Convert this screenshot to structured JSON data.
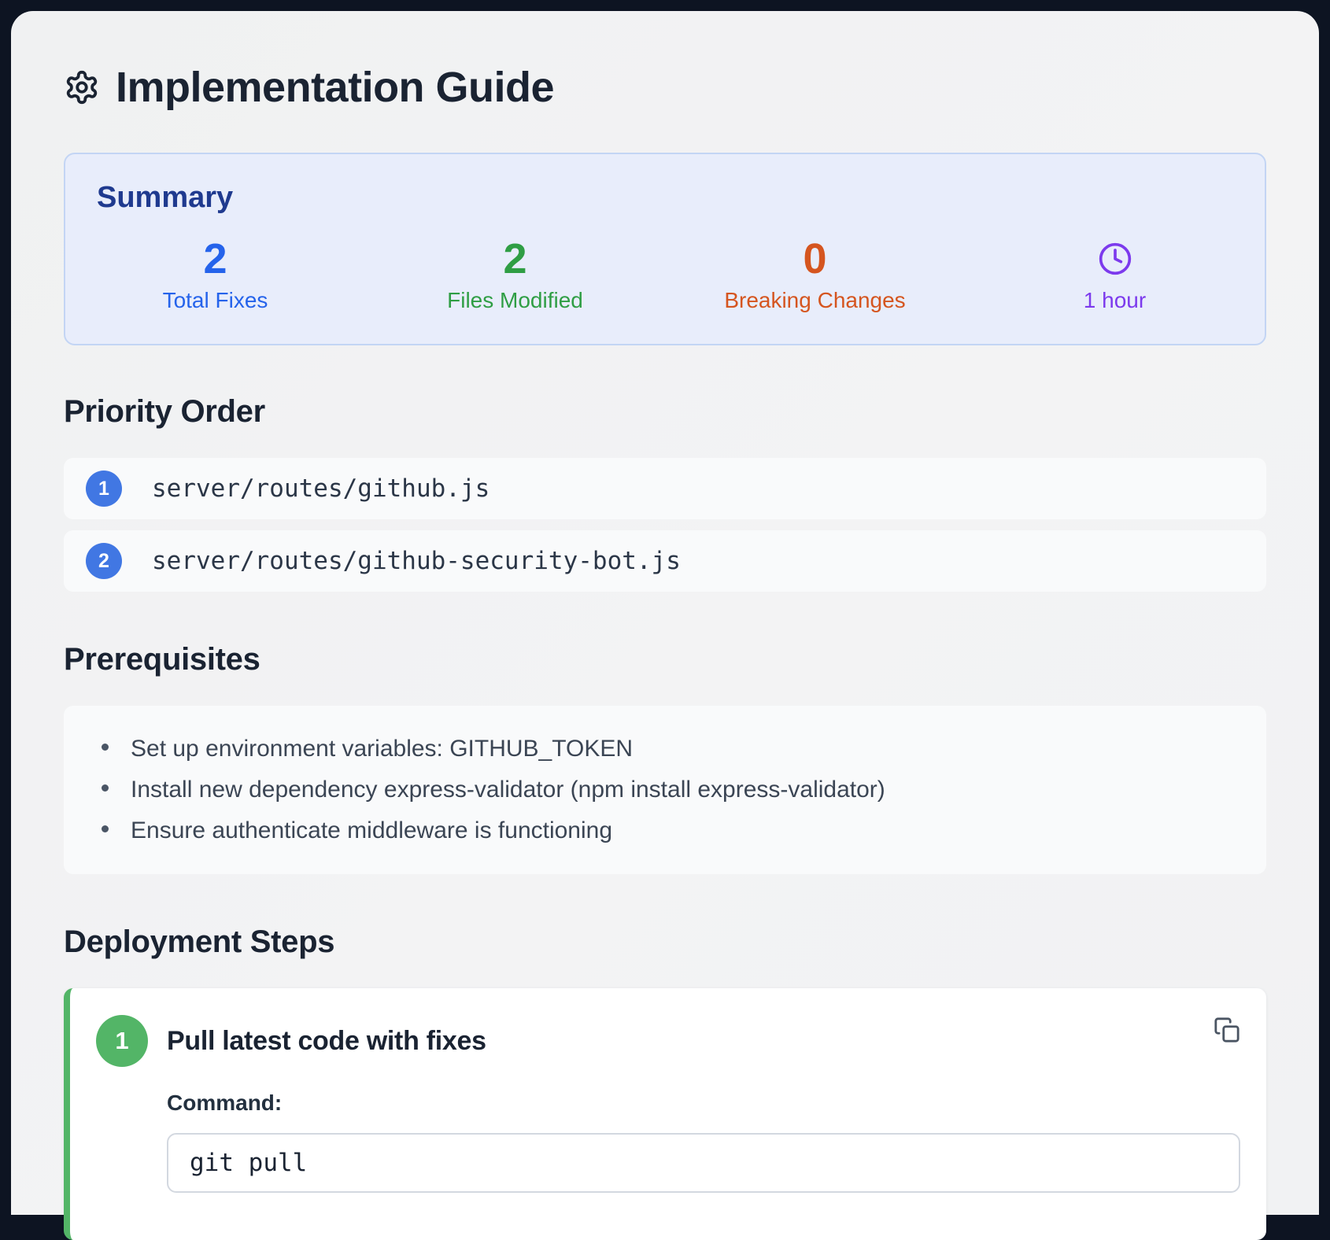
{
  "page": {
    "title": "Implementation Guide"
  },
  "summary": {
    "title": "Summary",
    "stats": [
      {
        "value": "2",
        "label": "Total Fixes",
        "color": "#2563eb",
        "icon": "none"
      },
      {
        "value": "2",
        "label": "Files Modified",
        "color": "#2f9e44",
        "icon": "none"
      },
      {
        "value": "0",
        "label": "Breaking Changes",
        "color": "#d5551f",
        "icon": "none"
      },
      {
        "value": "",
        "label": "1 hour",
        "color": "#7c3aed",
        "icon": "clock"
      }
    ]
  },
  "priority_order": {
    "heading": "Priority Order",
    "items": [
      {
        "number": "1",
        "path": "server/routes/github.js"
      },
      {
        "number": "2",
        "path": "server/routes/github-security-bot.js"
      }
    ]
  },
  "prerequisites": {
    "heading": "Prerequisites",
    "items": [
      "Set up environment variables: GITHUB_TOKEN",
      "Install new dependency express-validator (npm install express-validator)",
      "Ensure authenticate middleware is functioning"
    ]
  },
  "deployment": {
    "heading": "Deployment Steps",
    "steps": [
      {
        "number": "1",
        "title": "Pull latest code with fixes",
        "command_label": "Command:",
        "command": "git pull"
      }
    ]
  },
  "colors": {
    "frame_background": "#0d1422",
    "panel_background": "#f1f2f3",
    "summary_background": "#e8edfb",
    "summary_border": "#c3d5f4",
    "summary_title": "#1f3a8f",
    "heading_text": "#1a2332",
    "priority_badge": "#4177e3",
    "step_accent_green": "#53b567"
  }
}
